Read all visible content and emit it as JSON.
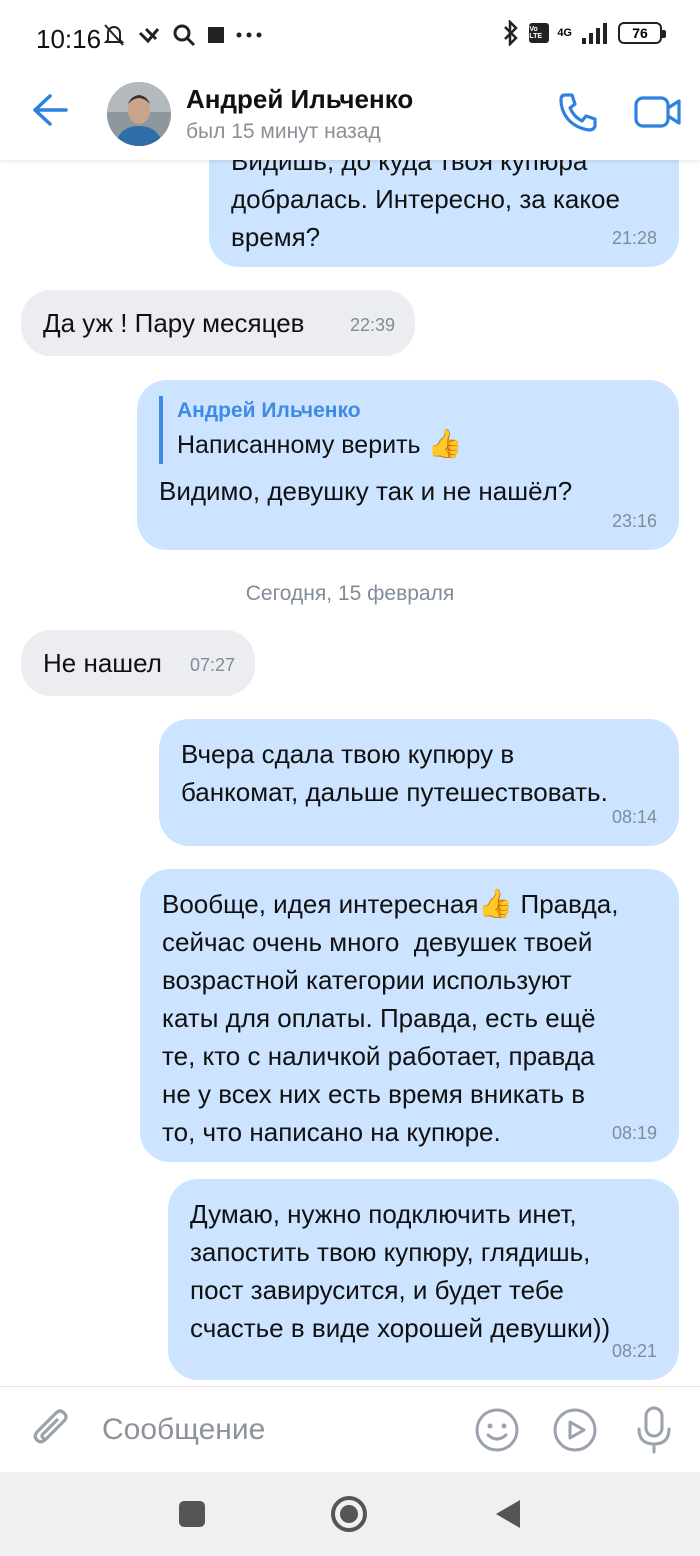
{
  "status_bar": {
    "time": "10:16",
    "network": "4G",
    "battery": "76"
  },
  "header": {
    "contact_name": "Андрей Ильченко",
    "last_seen": "был 15 минут назад"
  },
  "messages": [
    {
      "direction": "out",
      "text": "Видишь, до куда твоя купюра\nдобралась. Интересно, за какое\nвремя?",
      "time": "21:28"
    },
    {
      "direction": "in",
      "text": "Да уж ! Пару месяцев",
      "time": "22:39"
    },
    {
      "direction": "out",
      "reply_author": "Андрей Ильченко",
      "reply_text": "Написанному верить",
      "text": "Видимо, девушку так и не нашёл?",
      "time": "23:16"
    },
    {
      "direction": "in",
      "text": "Не нашел",
      "time": "07:27"
    },
    {
      "direction": "out",
      "text": "Вчера сдала твою купюру в\nбанкомат, дальше путешествовать.",
      "time": "08:14"
    },
    {
      "direction": "out",
      "text_before": "Вообще, идея интересная",
      "text": " Правда,\nсейчас очень много  девушек твоей\nвозрастной категории используют\nкаты для оплаты. Правда, есть ещё\nте, кто с наличкой работает, правда\nне у всех них есть время вникать в\nто, что написано на купюре.",
      "time": "08:19"
    },
    {
      "direction": "out",
      "text": "Думаю, нужно подключить инет,\nзапостить твою купюру, глядишь,\nпост завирусится, и будет тебе\nсчастье в виде хорошей девушки))",
      "time": "08:21"
    }
  ],
  "date_separator": "Сегодня, 15 февраля",
  "composer": {
    "placeholder": "Сообщение"
  },
  "icons": {
    "back": "arrow-left-icon",
    "call": "phone-icon",
    "video": "video-camera-icon",
    "attach": "paperclip-icon",
    "emoji": "smile-icon",
    "sticker": "play-circle-icon",
    "mic": "microphone-icon"
  },
  "colors": {
    "accent": "#2d81e0",
    "outgoing_bubble": "#cce4ff",
    "incoming_bubble": "#ebedf0",
    "secondary_text": "#818c99"
  }
}
